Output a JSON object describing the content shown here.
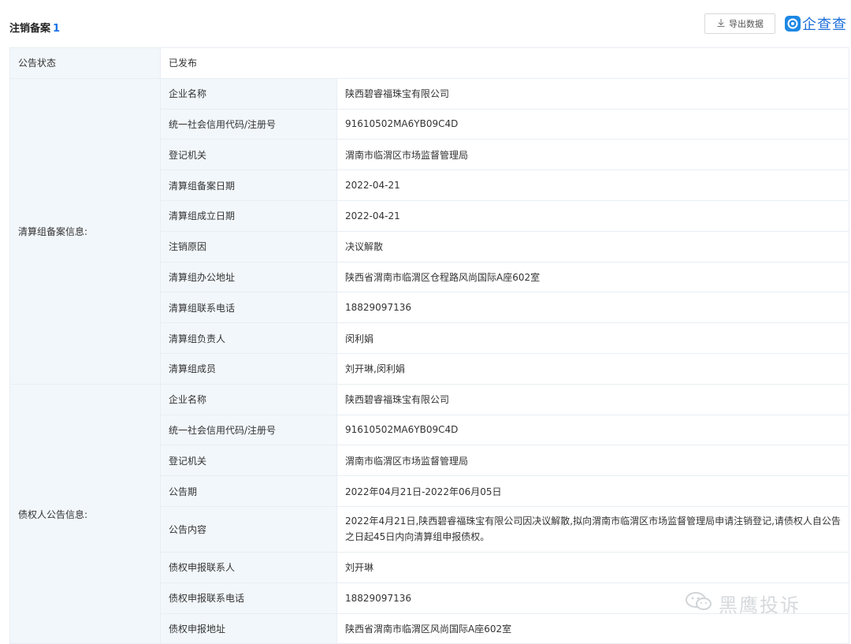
{
  "header": {
    "title": "注销备案",
    "count": "1",
    "export_label": "导出数据",
    "logo_text": "企查查",
    "brand_color": "#1e88e5",
    "count_color": "#1a73e8"
  },
  "status": {
    "label": "公告状态",
    "value": "已发布"
  },
  "liquidation": {
    "label": "清算组备案信息:",
    "rows": [
      {
        "field": "企业名称",
        "value": "陕西碧睿福珠宝有限公司"
      },
      {
        "field": "统一社会信用代码/注册号",
        "value": "91610502MA6YB09C4D"
      },
      {
        "field": "登记机关",
        "value": "渭南市临渭区市场监督管理局"
      },
      {
        "field": "清算组备案日期",
        "value": "2022-04-21"
      },
      {
        "field": "清算组成立日期",
        "value": "2022-04-21"
      },
      {
        "field": "注销原因",
        "value": "决议解散"
      },
      {
        "field": "清算组办公地址",
        "value": "陕西省渭南市临渭区仓程路风尚国际A座602室"
      },
      {
        "field": "清算组联系电话",
        "value": "18829097136"
      },
      {
        "field": "清算组负责人",
        "value": "闵利娟"
      },
      {
        "field": "清算组成员",
        "value": "刘开琳,闵利娟"
      }
    ]
  },
  "creditor": {
    "label": "债权人公告信息:",
    "rows": [
      {
        "field": "企业名称",
        "value": "陕西碧睿福珠宝有限公司"
      },
      {
        "field": "统一社会信用代码/注册号",
        "value": "91610502MA6YB09C4D"
      },
      {
        "field": "登记机关",
        "value": "渭南市临渭区市场监督管理局"
      },
      {
        "field": "公告期",
        "value": "2022年04月21日-2022年06月05日"
      },
      {
        "field": "公告内容",
        "value": "2022年4月21日,陕西碧睿福珠宝有限公司因决议解散,拟向渭南市临渭区市场监督管理局申请注销登记,请债权人自公告之日起45日内向清算组申报债权。"
      },
      {
        "field": "债权申报联系人",
        "value": "刘开琳"
      },
      {
        "field": "债权申报联系电话",
        "value": "18829097136"
      },
      {
        "field": "债权申报地址",
        "value": "陕西省渭南市临渭区风尚国际A座602室"
      }
    ]
  },
  "watermark": {
    "text": "黑鹰投诉",
    "icon": "wechat-icon"
  }
}
